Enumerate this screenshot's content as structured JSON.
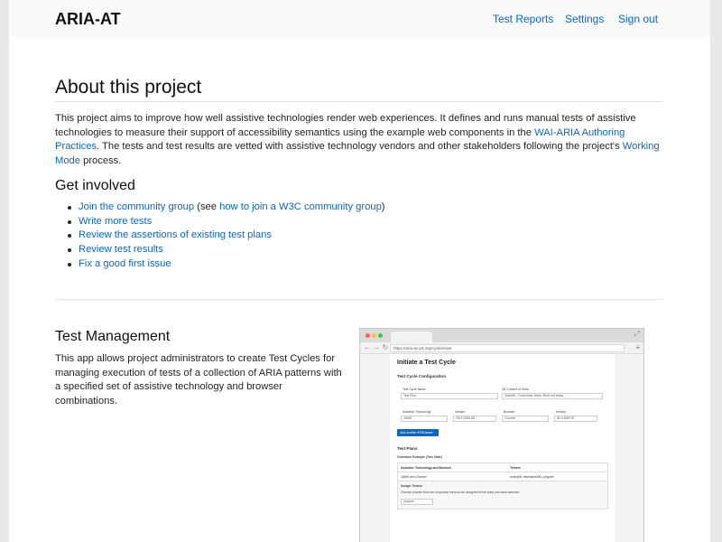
{
  "app": {
    "brand": "ARIA-AT"
  },
  "nav": {
    "items": [
      "Test Reports",
      "Settings",
      "Sign out"
    ]
  },
  "about": {
    "title": "About this project",
    "p1": "This project aims to improve how well assistive technologies render web experiences. It defines and runs manual tests of assistive technologies to measure their support of accessibility semantics using the example web components in the ",
    "link1": "WAI-ARIA Authoring Practices",
    "p2": ". The tests and test results are vetted with assistive technology vendors and other stakeholders following the project's ",
    "link2": "Working Mode",
    "p3": " process."
  },
  "involved": {
    "title": "Get involved",
    "items": [
      {
        "link": "Join the community group",
        "pre": " (see ",
        "link2": "how to join a W3C community group",
        "post": ")"
      },
      {
        "link": "Write more tests"
      },
      {
        "link": "Review the assertions of existing test plans"
      },
      {
        "link": "Review test results"
      },
      {
        "link": "Fix a good first issue"
      }
    ]
  },
  "test_management": {
    "title": "Test Management",
    "text": "This app allows project administrators to create Test Cycles for managing execution of tests of a collection of ARIA patterns with a specified set of assistive technology and browser combinations."
  },
  "screenshot": {
    "url": "https://aria-at.w3.org/cycles/new",
    "heading": "Initiate a Test Cycle",
    "config_title": "Test Cycle Configuration",
    "cycle_name_label": "Test Cycle Name",
    "cycle_name_value": "Test Pilot",
    "git_label": "Git Commit of Tests",
    "git_value": "3c5e4f6 - Combobox Tests: Work not ready…",
    "at_label": "Assistive Technology",
    "at_value": "JAWS",
    "version_label": "Version",
    "at_version": "2019.1906.68",
    "browser_label": "Browser",
    "browser_value": "Chrome",
    "browser_version_label": "Version",
    "browser_version": "80.0.3987.87",
    "add_button": "Add another AT/Browser",
    "plans_title": "Test Plans",
    "plan_name": "Checkbox Example (Two State)",
    "col_at": "Assistive Technology and Browser",
    "col_testers": "Testers",
    "row_at": "JAWS and Chrome",
    "row_testers": "evan@6, mikemike380, jongund",
    "assign_title": "Assign Testers",
    "assign_hint": "Choose a tester from the dropdown menu to be assigned to the tests you have selected",
    "assign_value": "jongund"
  }
}
